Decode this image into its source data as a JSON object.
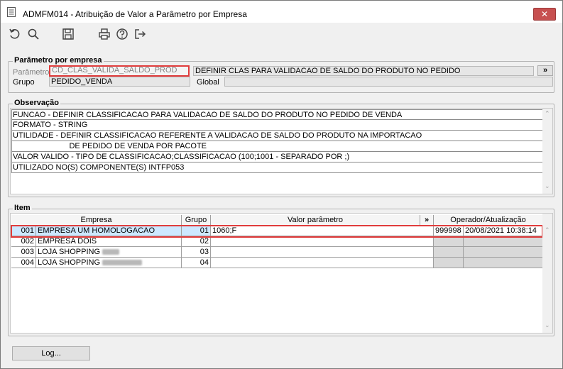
{
  "window": {
    "title": "ADMFM014 - Atribuição de Valor a Parâmetro por Empresa",
    "close_label": "✕"
  },
  "toolbar": {
    "icons": [
      "undo-icon",
      "search-icon",
      "save-icon",
      "print-icon",
      "help-icon",
      "exit-icon"
    ]
  },
  "parametro_group": {
    "title": "Parâmetro por empresa",
    "parametro_label": "Parâmetro",
    "parametro_value": "CD_CLAS_VALIDA_SALDO_PROD",
    "parametro_desc": "DEFINIR CLAS PARA VALIDACAO DE SALDO DO PRODUTO NO PEDIDO",
    "more_label": "»",
    "grupo_label": "Grupo",
    "grupo_value": "PEDIDO_VENDA",
    "global_label": "Global",
    "global_value": ""
  },
  "observacao": {
    "title": "Observação",
    "lines": [
      "FUNCAO - DEFINIR CLASSIFICACAO PARA VALIDACAO DE SALDO DO PRODUTO NO PEDIDO DE VENDA",
      "FORMATO - STRING",
      "UTILIDADE - DEFINIR CLASSIFICACAO REFERENTE A VALIDACAO DE SALDO DO PRODUTO NA IMPORTACAO",
      "                          DE PEDIDO DE VENDA POR PACOTE",
      "VALOR VALIDO - TIPO DE CLASSIFICACAO;CLASSIFICACAO (100;1001 - SEPARADO POR ;)",
      "UTILIZADO NO(S) COMPONENTE(S) INTFP053"
    ]
  },
  "item": {
    "title": "Item",
    "headers": {
      "empresa": "Empresa",
      "grupo": "Grupo",
      "valor": "Valor parâmetro",
      "more": "»",
      "operador": "Operador/Atualização"
    },
    "rows": [
      {
        "code": "001",
        "name": "EMPRESA UM HOMOLOGACAO",
        "grupo": "01",
        "valor": "1060;F",
        "operador": "999998",
        "data": "20/08/2021 10:38:14",
        "blurred": false
      },
      {
        "code": "002",
        "name": "EMPRESA DOIS",
        "grupo": "02",
        "valor": "",
        "operador": "",
        "data": "",
        "blurred": false
      },
      {
        "code": "003",
        "name": "LOJA SHOPPING",
        "grupo": "03",
        "valor": "",
        "operador": "",
        "data": "",
        "blurred": true
      },
      {
        "code": "004",
        "name": "LOJA SHOPPING",
        "grupo": "04",
        "valor": "",
        "operador": "",
        "data": "",
        "blurred": true
      }
    ]
  },
  "footer": {
    "log_label": "Log..."
  }
}
